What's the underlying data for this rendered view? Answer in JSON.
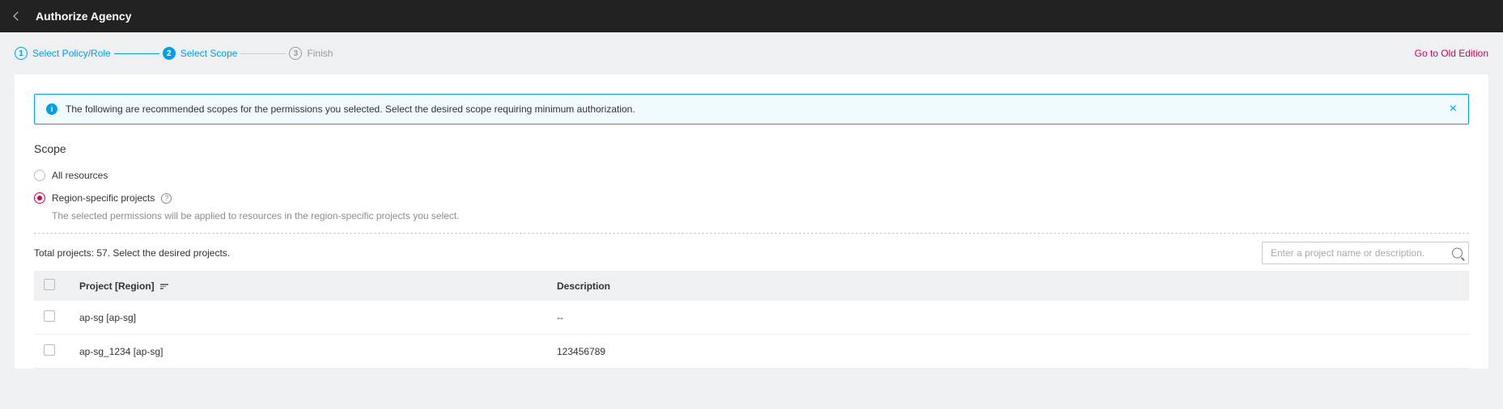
{
  "header": {
    "title": "Authorize Agency"
  },
  "steps": [
    {
      "num": "1",
      "label": "Select Policy/Role",
      "state": "done"
    },
    {
      "num": "2",
      "label": "Select Scope",
      "state": "current"
    },
    {
      "num": "3",
      "label": "Finish",
      "state": "pending"
    }
  ],
  "old_edition_link": "Go to Old Edition",
  "alert": {
    "text": "The following are recommended scopes for the permissions you selected. Select the desired scope requiring minimum authorization.",
    "info_glyph": "i",
    "close_glyph": "×"
  },
  "scope": {
    "title": "Scope",
    "options": {
      "all": {
        "label": "All resources",
        "selected": false
      },
      "region": {
        "label": "Region-specific projects",
        "help_glyph": "?",
        "desc": "The selected permissions will be applied to resources in the region-specific projects you select.",
        "selected": true
      }
    }
  },
  "projects": {
    "total_text": "Total projects: 57. Select the desired projects.",
    "search_placeholder": "Enter a project name or description.",
    "columns": {
      "project": "Project [Region]",
      "description": "Description"
    },
    "rows": [
      {
        "project": "ap-sg [ap-sg]",
        "description": "--"
      },
      {
        "project": "ap-sg_1234 [ap-sg]",
        "description": "123456789"
      }
    ]
  }
}
